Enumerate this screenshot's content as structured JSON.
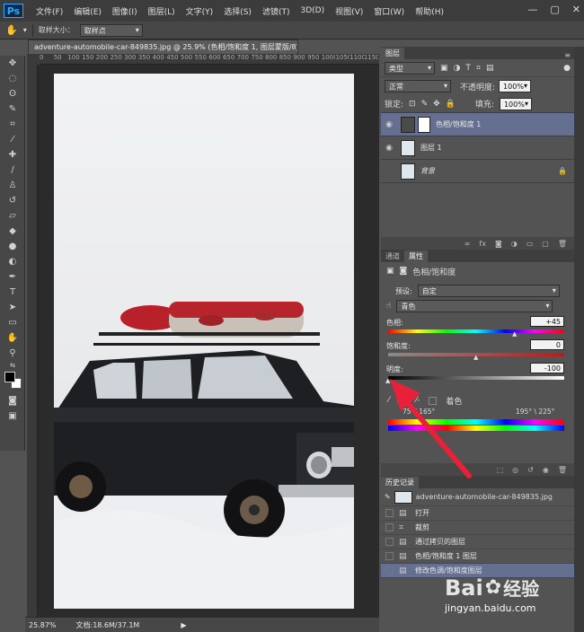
{
  "app": {
    "logo": "Ps"
  },
  "menu": [
    "文件(F)",
    "编辑(E)",
    "图像(I)",
    "图层(L)",
    "文字(Y)",
    "选择(S)",
    "滤镜(T)",
    "3D(D)",
    "视图(V)",
    "窗口(W)",
    "帮助(H)"
  ],
  "window_controls": {
    "minimize": "—",
    "maximize": "▢",
    "close": "✕"
  },
  "options_bar": {
    "sample_size_label": "取样大小：",
    "sample_size_value": "取样点"
  },
  "document": {
    "tab_title": "adventure-automobile-car-849835.jpg @ 25.9% (色相/饱和度 1, 图层蒙版/8) *",
    "close": "×"
  },
  "ruler": {
    "ticks": [
      "0",
      "50",
      "100",
      "150",
      "200",
      "250",
      "300",
      "350",
      "400",
      "450",
      "500",
      "550",
      "600",
      "650",
      "700",
      "750",
      "800",
      "850",
      "900",
      "950",
      "1000",
      "1050",
      "1100",
      "1150"
    ]
  },
  "status": {
    "zoom": "25.87%",
    "doc_info": "文档:18.6M/37.1M"
  },
  "layers_panel": {
    "tab": "图层",
    "filter_kind": "类型",
    "blend_mode": "正常",
    "opacity_label": "不透明度:",
    "opacity_value": "100%",
    "lock_label": "锁定:",
    "fill_label": "填充:",
    "fill_value": "100%",
    "layers": [
      {
        "name": "色相/饱和度 1",
        "selected": true
      },
      {
        "name": "图层 1",
        "selected": false
      },
      {
        "name": "背景",
        "selected": false
      }
    ]
  },
  "properties_panel": {
    "tabs": [
      "通道",
      "属性"
    ],
    "title": "色相/饱和度",
    "preset_label": "预设:",
    "preset_value": "自定",
    "channel_value": "青色",
    "hue_label": "色相:",
    "hue_value": "+45",
    "saturation_label": "饱和度:",
    "saturation_value": "0",
    "lightness_label": "明度:",
    "lightness_value": "-100",
    "colorize_label": "着色",
    "range_left": "75°/ 165°",
    "range_right": "195° \\ 225°"
  },
  "history_panel": {
    "tab": "历史记录",
    "snapshot": "adventure-automobile-car-849835.jpg",
    "items": [
      "打开",
      "裁剪",
      "通过拷贝的图层",
      "色相/饱和度 1 图层",
      "修改色调/饱和度图层"
    ]
  },
  "watermark": {
    "brand": "Bai",
    "brand2": "经验",
    "url": "jingyan.baidu.com"
  },
  "colors": {
    "accent_layer_select": "#657090",
    "arrow": "#e8203a"
  }
}
